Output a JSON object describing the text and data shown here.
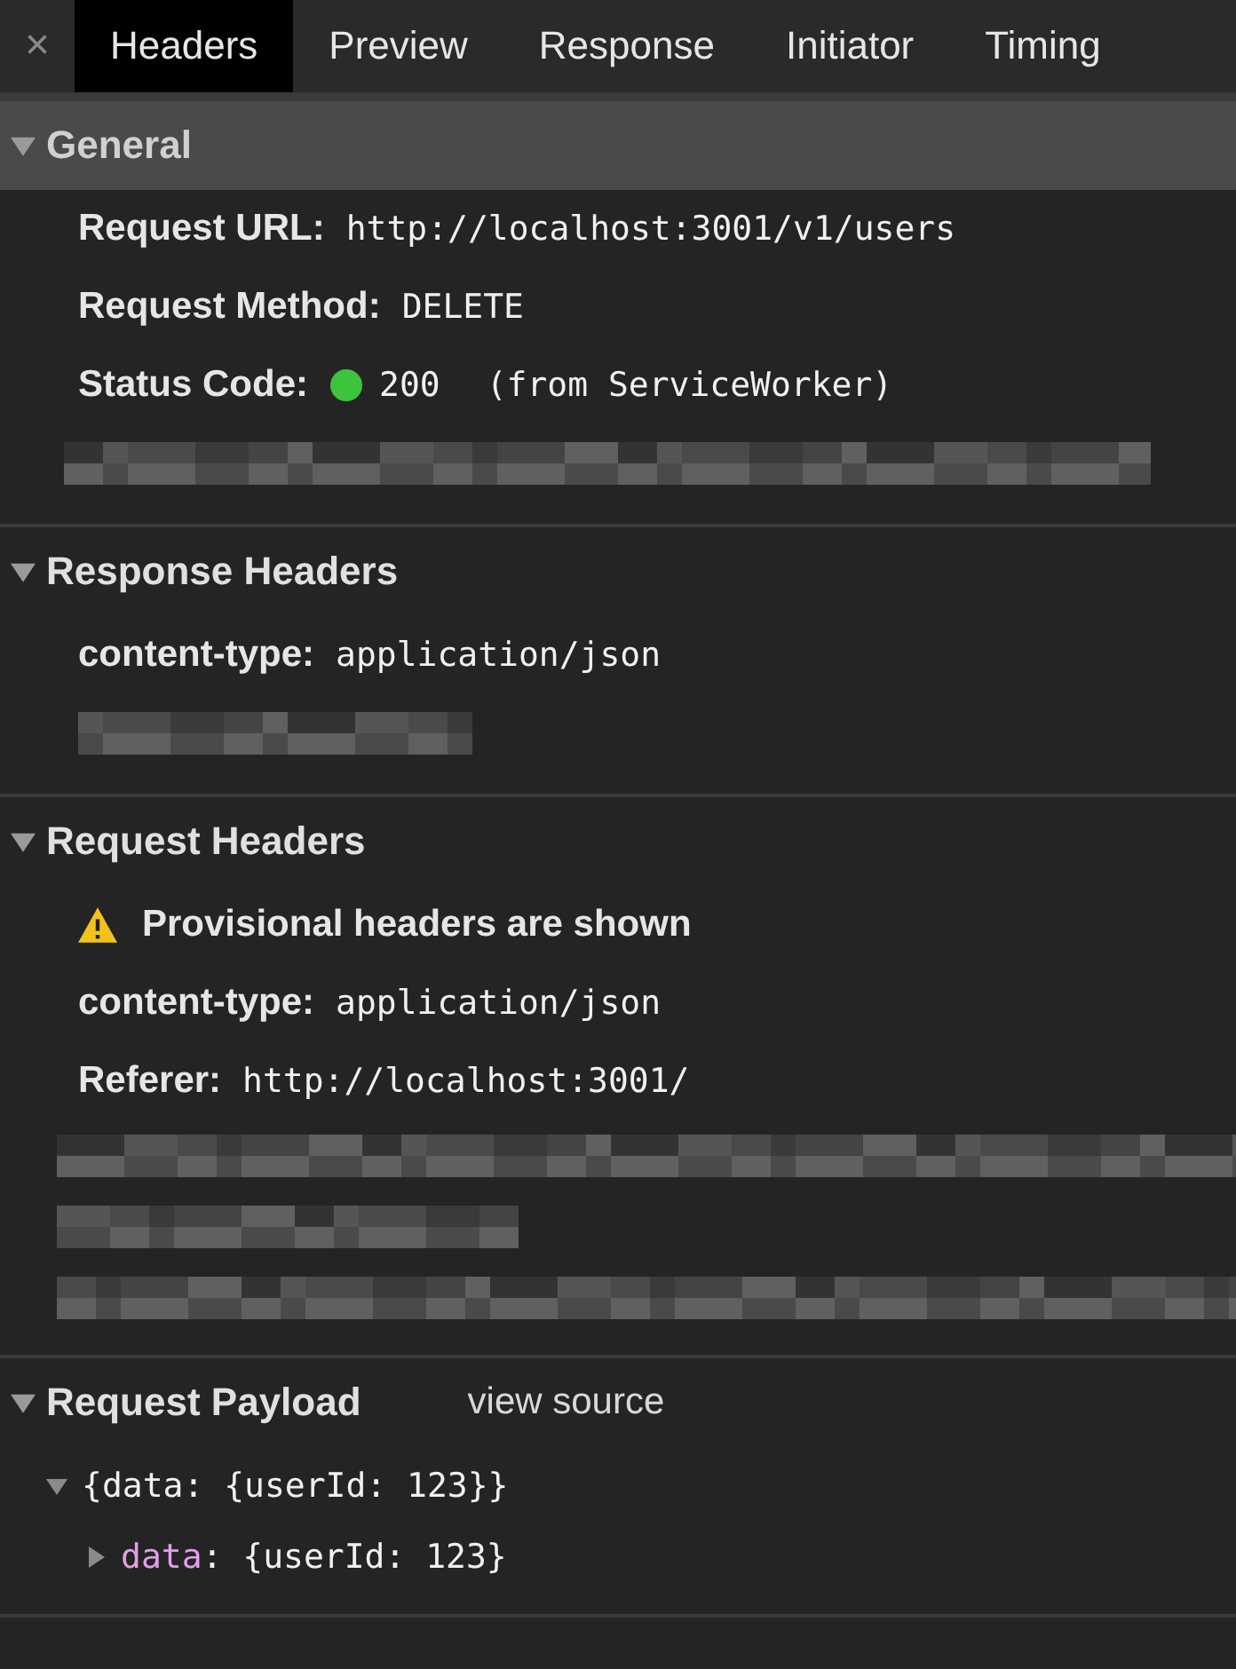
{
  "close_icon": "×",
  "tabs": [
    {
      "label": "Headers",
      "selected": true
    },
    {
      "label": "Preview",
      "selected": false
    },
    {
      "label": "Response",
      "selected": false
    },
    {
      "label": "Initiator",
      "selected": false
    },
    {
      "label": "Timing",
      "selected": false
    }
  ],
  "sections": [
    {
      "title": "General",
      "expanded": true,
      "selected": true,
      "rows": [
        {
          "kind": "pair",
          "name": "Request URL:",
          "value": "http://localhost:3001/v1/users"
        },
        {
          "kind": "pair",
          "name": "Request Method:",
          "value": "DELETE"
        },
        {
          "kind": "status",
          "name": "Status Code:",
          "color": "#3cc43c",
          "value": "200",
          "note": "(from ServiceWorker)"
        },
        {
          "kind": "redacted"
        }
      ]
    },
    {
      "title": "Response Headers",
      "expanded": true,
      "selected": false,
      "rows": [
        {
          "kind": "pair",
          "name": "content-type:",
          "value": "application/json"
        },
        {
          "kind": "redacted"
        }
      ]
    },
    {
      "title": "Request Headers",
      "expanded": true,
      "selected": false,
      "rows": [
        {
          "kind": "warning",
          "text": "Provisional headers are shown"
        },
        {
          "kind": "pair",
          "name": "content-type:",
          "value": "application/json"
        },
        {
          "kind": "pair",
          "name": "Referer:",
          "value": "http://localhost:3001/"
        },
        {
          "kind": "redacted"
        },
        {
          "kind": "redacted"
        },
        {
          "kind": "redacted"
        }
      ]
    },
    {
      "title": "Request Payload",
      "expanded": true,
      "selected": false,
      "link": "view source",
      "tree": [
        {
          "text": "{data: {userId: 123}}",
          "expanded": true,
          "children": [
            {
              "key": "data",
              "text": ": {userId: 123}",
              "expanded": false
            }
          ]
        }
      ]
    }
  ]
}
